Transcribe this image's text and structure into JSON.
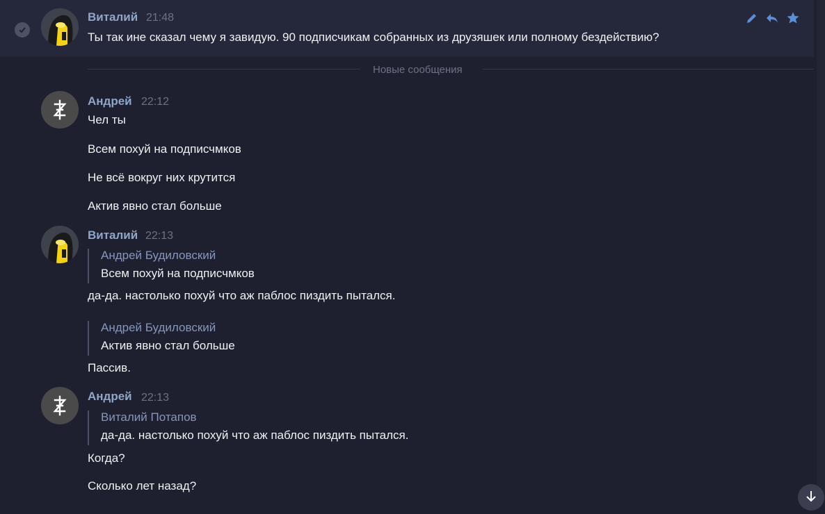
{
  "colors": {
    "background": "#1e2030",
    "author": "#8fa6c9",
    "accent": "#5b8ed6"
  },
  "new_messages_label": "Новые сообщения",
  "msg1": {
    "author": "Виталий",
    "time": "21:48",
    "text": "Ты так ине сказал чему я завидую. 90 подписчикам собранных из друзяшек или полному бездействию?"
  },
  "msg2": {
    "author": "Андрей",
    "time": "22:12",
    "lines": [
      "Чел ты",
      "Всем похуй на подписчмков",
      "Не всё вокруг них крутится",
      "Актив явно стал больше"
    ]
  },
  "msg3": {
    "author": "Виталий",
    "time": "22:13",
    "quote1": {
      "author": "Андрей Будиловский",
      "text": "Всем похуй на подписчмков"
    },
    "reply1": "да-да. настолько похуй что аж паблос пиздить пытался.",
    "quote2": {
      "author": "Андрей Будиловский",
      "text": "Актив явно стал больше"
    },
    "reply2": "Пассив."
  },
  "msg4": {
    "author": "Андрей",
    "time": "22:13",
    "quote": {
      "author": "Виталий Потапов",
      "text": "да-да. настолько похуй что аж паблос пиздить пытался."
    },
    "lines": [
      "Когда?",
      "Сколько лет назад?"
    ]
  },
  "icons": [
    "check-icon",
    "edit-icon",
    "reply-icon",
    "star-icon",
    "arrow-down-icon"
  ]
}
